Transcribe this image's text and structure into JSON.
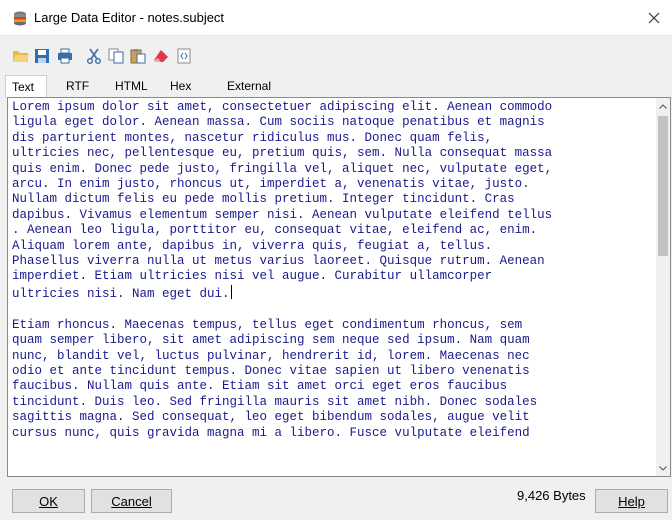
{
  "window": {
    "title": "Large Data Editor - notes.subject"
  },
  "toolbar": {
    "buttons": [
      {
        "name": "open-icon"
      },
      {
        "name": "save-icon"
      },
      {
        "name": "print-icon"
      },
      {
        "name": "cut-icon"
      },
      {
        "name": "copy-icon"
      },
      {
        "name": "paste-icon"
      },
      {
        "name": "eraser-icon"
      },
      {
        "name": "code-icon"
      }
    ]
  },
  "tabs": [
    {
      "label": "Text",
      "active": true
    },
    {
      "label": "RTF",
      "active": false
    },
    {
      "label": "HTML",
      "active": false
    },
    {
      "label": "Hex",
      "active": false
    },
    {
      "label": "External",
      "active": false
    }
  ],
  "editor": {
    "lines": [
      "Lorem ipsum dolor sit amet, consectetuer adipiscing elit. Aenean commodo",
      "ligula eget dolor. Aenean massa. Cum sociis natoque penatibus et magnis",
      "dis parturient montes, nascetur ridiculus mus. Donec quam felis,",
      "ultricies nec, pellentesque eu, pretium quis, sem. Nulla consequat massa",
      "quis enim. Donec pede justo, fringilla vel, aliquet nec, vulputate eget,",
      "arcu. In enim justo, rhoncus ut, imperdiet a, venenatis vitae, justo.",
      "Nullam dictum felis eu pede mollis pretium. Integer tincidunt. Cras",
      "dapibus. Vivamus elementum semper nisi. Aenean vulputate eleifend tellus",
      ". Aenean leo ligula, porttitor eu, consequat vitae, eleifend ac, enim.",
      "Aliquam lorem ante, dapibus in, viverra quis, feugiat a, tellus.",
      "Phasellus viverra nulla ut metus varius laoreet. Quisque rutrum. Aenean",
      "imperdiet. Etiam ultricies nisi vel augue. Curabitur ullamcorper",
      "ultricies nisi. Nam eget dui.",
      "",
      "Etiam rhoncus. Maecenas tempus, tellus eget condimentum rhoncus, sem",
      "quam semper libero, sit amet adipiscing sem neque sed ipsum. Nam quam",
      "nunc, blandit vel, luctus pulvinar, hendrerit id, lorem. Maecenas nec",
      "odio et ante tincidunt tempus. Donec vitae sapien ut libero venenatis",
      "faucibus. Nullam quis ante. Etiam sit amet orci eget eros faucibus",
      "tincidunt. Duis leo. Sed fringilla mauris sit amet nibh. Donec sodales",
      "sagittis magna. Sed consequat, leo eget bibendum sodales, augue velit",
      "cursus nunc, quis gravida magna mi a libero. Fusce vulputate eleifend"
    ],
    "caret_line": 12,
    "text_color": "#1a1a8c"
  },
  "footer": {
    "ok_label": "OK",
    "cancel_label": "Cancel",
    "bytes_label": "9,426 Bytes",
    "help_label": "Help"
  }
}
